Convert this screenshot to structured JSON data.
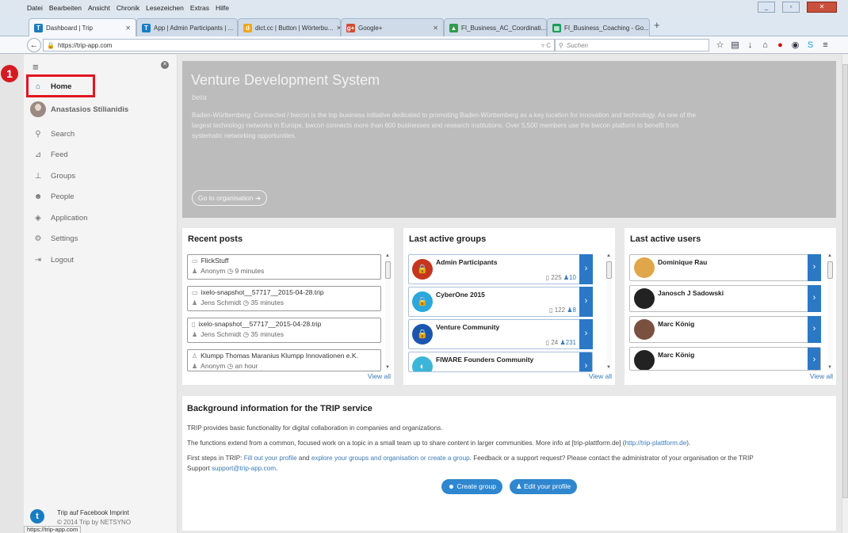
{
  "browser": {
    "menu": [
      "Datei",
      "Bearbeiten",
      "Ansicht",
      "Chronik",
      "Lesezeichen",
      "Extras",
      "Hilfe"
    ],
    "tabs": [
      {
        "title": "Dashboard | Trip",
        "favicon": "T"
      },
      {
        "title": "App | Admin Participants | ...",
        "favicon": "T"
      },
      {
        "title": "dict.cc | Button | Wörterbu...",
        "favicon": "d"
      },
      {
        "title": "Google+",
        "favicon": "g+"
      },
      {
        "title": "FI_Business_AC_Coordinati...",
        "favicon": "▲"
      },
      {
        "title": "FI_Business_Coaching - Go...",
        "favicon": "▦"
      }
    ],
    "new_tab": "+",
    "url": "https://trip-app.com",
    "search_placeholder": "Suchen",
    "status_url": "https://trip-app.com"
  },
  "sidebar": {
    "marker_number": "1",
    "items": [
      {
        "label": "Home",
        "icon": "home-icon"
      },
      {
        "label": "Anastasios Stilianidis",
        "icon": "avatar"
      },
      {
        "label": "Search",
        "icon": "search-icon"
      },
      {
        "label": "Feed",
        "icon": "rss-icon"
      },
      {
        "label": "Groups",
        "icon": "sitemap-icon"
      },
      {
        "label": "People",
        "icon": "users-icon"
      },
      {
        "label": "Application",
        "icon": "cube-icon"
      },
      {
        "label": "Settings",
        "icon": "gear-icon"
      },
      {
        "label": "Logout",
        "icon": "logout-icon"
      }
    ],
    "footer": {
      "logo": "t",
      "line1": "Trip auf Facebook  Imprint",
      "line2": "© 2014 Trip by NETSYNO"
    }
  },
  "hero": {
    "title": "Venture Development System",
    "subtitle": "beta",
    "description": "Baden-Württemberg: Connected / bwcon is the top business initiative dedicated to promoting Baden-Württemberg as a key location for innovation and technology. As one of the largest technology networks in Europe, bwcon connects more than 600 businesses and research institutions. Over 5,500 members use the bwcon platform to benefit from systematic networking opportunities.",
    "button": "Go to organisation"
  },
  "recent_posts": {
    "title": "Recent posts",
    "view_all": "View all",
    "items": [
      {
        "title": "FlickStuff",
        "author": "Anonym",
        "time": "9 minutes"
      },
      {
        "title": "ixelo-snapshot__57717__2015-04-28.trip",
        "author": "Jens Schmidt",
        "time": "35 minutes"
      },
      {
        "title": "ixelo-snapshot__57717__2015-04-28.trip",
        "author": "Jens Schmidt",
        "time": "35 minutes"
      },
      {
        "title": "Klumpp Thomas Maranius Klumpp Innovationen e.K.",
        "author": "Anonym",
        "time": "an hour"
      }
    ]
  },
  "last_groups": {
    "title": "Last active groups",
    "view_all": "View all",
    "items": [
      {
        "name": "Admin Participants",
        "files": "225",
        "members": "10",
        "color": "#c6361e"
      },
      {
        "name": "CyberOne 2015",
        "files": "122",
        "members": "8",
        "color": "#2aa8dd"
      },
      {
        "name": "Venture Community",
        "files": "24",
        "members": "231",
        "color": "#1a56b0"
      },
      {
        "name": "FIWARE Founders Community",
        "files": "",
        "members": "",
        "color": "#3cb6d8"
      }
    ]
  },
  "last_users": {
    "title": "Last active users",
    "view_all": "View all",
    "items": [
      {
        "name": "Dominique Rau"
      },
      {
        "name": "Janosch J Sadowski"
      },
      {
        "name": "Marc König"
      },
      {
        "name": "Marc König"
      }
    ]
  },
  "background": {
    "title": "Background information for the TRIP service",
    "p1": "TRIP provides basic functionality for digital collaboration in companies and organizations.",
    "p2a": "The functions extend from a common, focused work on a topic in a small team up to share content in larger communities. More info at [trip-plattform.de] (",
    "p2link": "http://trip-plattform.de",
    "p2b": ").",
    "p3a": "First steps in TRIP: ",
    "p3link1": "Fill out your profile",
    "p3b": " and ",
    "p3link2": "explore your groups and organisation or create a group",
    "p3c": ". Feedback or a support request? Please contact the administrator of your organisation or the TRIP",
    "p4a": "Support ",
    "p4link": "support@trip-app.com",
    "p4b": ".",
    "btn_create": "Create group",
    "btn_edit": "Edit your profile"
  }
}
